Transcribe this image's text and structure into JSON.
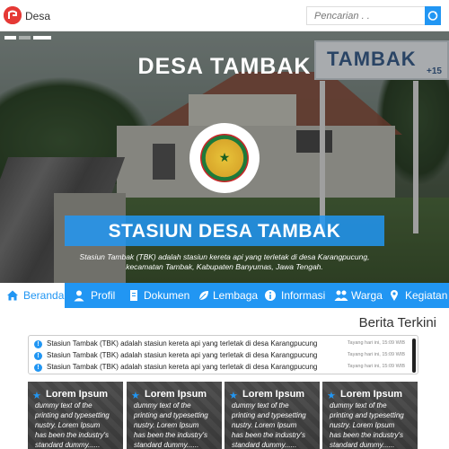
{
  "header": {
    "brand": "Desa",
    "search_placeholder": "Pencarian . ."
  },
  "hero": {
    "title": "DESA TAMBAK",
    "sign_text": "TAMBAK",
    "sign_sub": "+15",
    "caption": "STASIUN DESA TAMBAK",
    "description_line1": "Stasiun Tambak (TBK) adalah stasiun kereta api yang terletak di desa Karangpucung,",
    "description_line2": "kecamatan Tambak, Kabupaten Banyumas, Jawa Tengah."
  },
  "nav": {
    "items": [
      {
        "label": "Beranda",
        "icon": "home-icon"
      },
      {
        "label": "Profil",
        "icon": "user-icon"
      },
      {
        "label": "Dokumen",
        "icon": "document-icon"
      },
      {
        "label": "Lembaga",
        "icon": "leaf-icon"
      },
      {
        "label": "Informasi",
        "icon": "info-icon"
      },
      {
        "label": "Warga",
        "icon": "users-icon"
      },
      {
        "label": "Kegiatan",
        "icon": "pin-icon"
      }
    ]
  },
  "berita": {
    "title": "Berita Terkini",
    "items": [
      {
        "text": "Stasiun Tambak (TBK) adalah stasiun kereta api yang terletak di desa Karangpucung",
        "time": "Tayang hari ini, 15:09 WIB"
      },
      {
        "text": "Stasiun Tambak (TBK) adalah stasiun kereta api yang terletak di desa Karangpucung",
        "time": "Tayang hari ini, 15:09 WIB"
      },
      {
        "text": "Stasiun Tambak (TBK) adalah stasiun kereta api yang terletak di desa Karangpucung",
        "time": "Tayang hari ini, 15:09 WIB"
      }
    ]
  },
  "cards": [
    {
      "title": "Lorem Ipsum",
      "l1": "dummy text of the",
      "l2": "printing and typesetting",
      "l3": "nustry. Lorem Ipsum",
      "l4": "has been the industry's",
      "l5": "standard dummy......"
    },
    {
      "title": "Lorem Ipsum",
      "l1": "dummy text of the",
      "l2": "printing and typesetting",
      "l3": "nustry. Lorem Ipsum",
      "l4": "has been the industry's",
      "l5": "standard dummy......"
    },
    {
      "title": "Lorem Ipsum",
      "l1": "dummy text of the",
      "l2": "printing and typesetting",
      "l3": "nustry. Lorem Ipsum",
      "l4": "has been the industry's",
      "l5": "standard dummy......"
    },
    {
      "title": "Lorem Ipsum",
      "l1": "dummy text of the",
      "l2": "printing and typesetting",
      "l3": "nustry. Lorem Ipsum",
      "l4": "has been the industry's",
      "l5": "standard dummy......"
    }
  ],
  "colors": {
    "accent": "#2196f3",
    "logo": "#e53935"
  }
}
